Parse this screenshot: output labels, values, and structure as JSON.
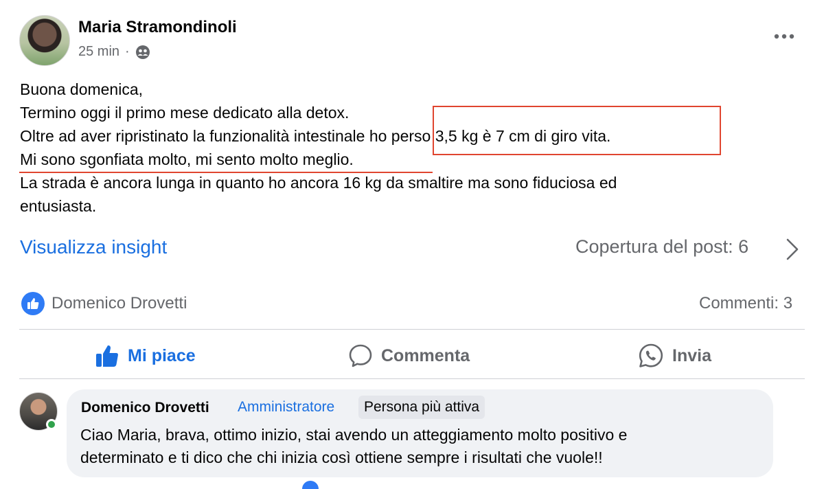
{
  "post": {
    "author": "Maria Stramondinoli",
    "time": "25 min",
    "separator": "·",
    "audience_icon": "group-icon",
    "lines": [
      "Buona domenica,",
      "Termino oggi il primo mese dedicato alla detox.",
      "Oltre ad aver ripristinato la funzionalità intestinale ho perso 3,5 kg è 7 cm di giro vita.",
      "Mi sono sgonfiata molto, mi sento molto meglio.",
      "La strada è ancora lunga in quanto ho ancora 16 kg da smaltire ma sono fiduciosa ed",
      "entusiasta."
    ],
    "highlight_color": "#e0452f"
  },
  "insights": {
    "link": "Visualizza insight",
    "coverage": "Copertura del post: 6"
  },
  "reactions": {
    "reactor": "Domenico Drovetti",
    "comments": "Commenti: 3"
  },
  "actions": {
    "like": "Mi piace",
    "comment": "Commenta",
    "send": "Invia"
  },
  "comment": {
    "author": "Domenico Drovetti",
    "role": "Amministratore",
    "badge": "Persona più attiva",
    "lines": [
      "Ciao Maria, brava, ottimo inizio, stai avendo un atteggiamento molto positivo e",
      "determinato e ti dico che chi inizia così ottiene sempre i risultati che vuole!!"
    ]
  },
  "colors": {
    "accent": "#1a6fe0",
    "secondary_text": "#65676b",
    "online": "#31a24c"
  }
}
